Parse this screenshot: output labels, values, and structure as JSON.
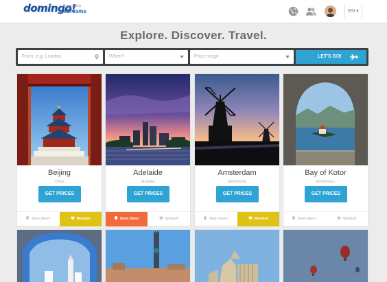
{
  "header": {
    "logo": "domingo!",
    "powered_by": "Powered by",
    "powered_brand": "eDreams",
    "language": "EN ▾"
  },
  "tagline": "Explore. Discover. Travel.",
  "search": {
    "from_placeholder": "From: e.g. London",
    "when_placeholder": "When?",
    "price_placeholder": "Price range",
    "go_label": "LET'S GO!"
  },
  "cards": [
    {
      "city": "Beijing",
      "country": "China",
      "button": "GET PRICES",
      "been": "Been there?",
      "wishlist": "Wishlist!",
      "been_active": false,
      "wish_active": true
    },
    {
      "city": "Adelaide",
      "country": "Australia",
      "button": "GET PRICES",
      "been": "Been there!",
      "wishlist": "Wishlist?",
      "been_active": true,
      "wish_active": false
    },
    {
      "city": "Amsterdam",
      "country": "Netherlands",
      "button": "GET PRICES",
      "been": "Been there?",
      "wishlist": "Wishlist!",
      "been_active": false,
      "wish_active": true
    },
    {
      "city": "Bay of Kotor",
      "country": "Montenegro",
      "button": "GET PRICES",
      "been": "Been there?",
      "wishlist": "Wishlist?",
      "been_active": false,
      "wish_active": false
    }
  ],
  "colors": {
    "accent_blue": "#2ea3d4",
    "wishlist_yellow": "#e0c214",
    "been_orange": "#f26a3b",
    "searchbar": "#3b4347"
  }
}
